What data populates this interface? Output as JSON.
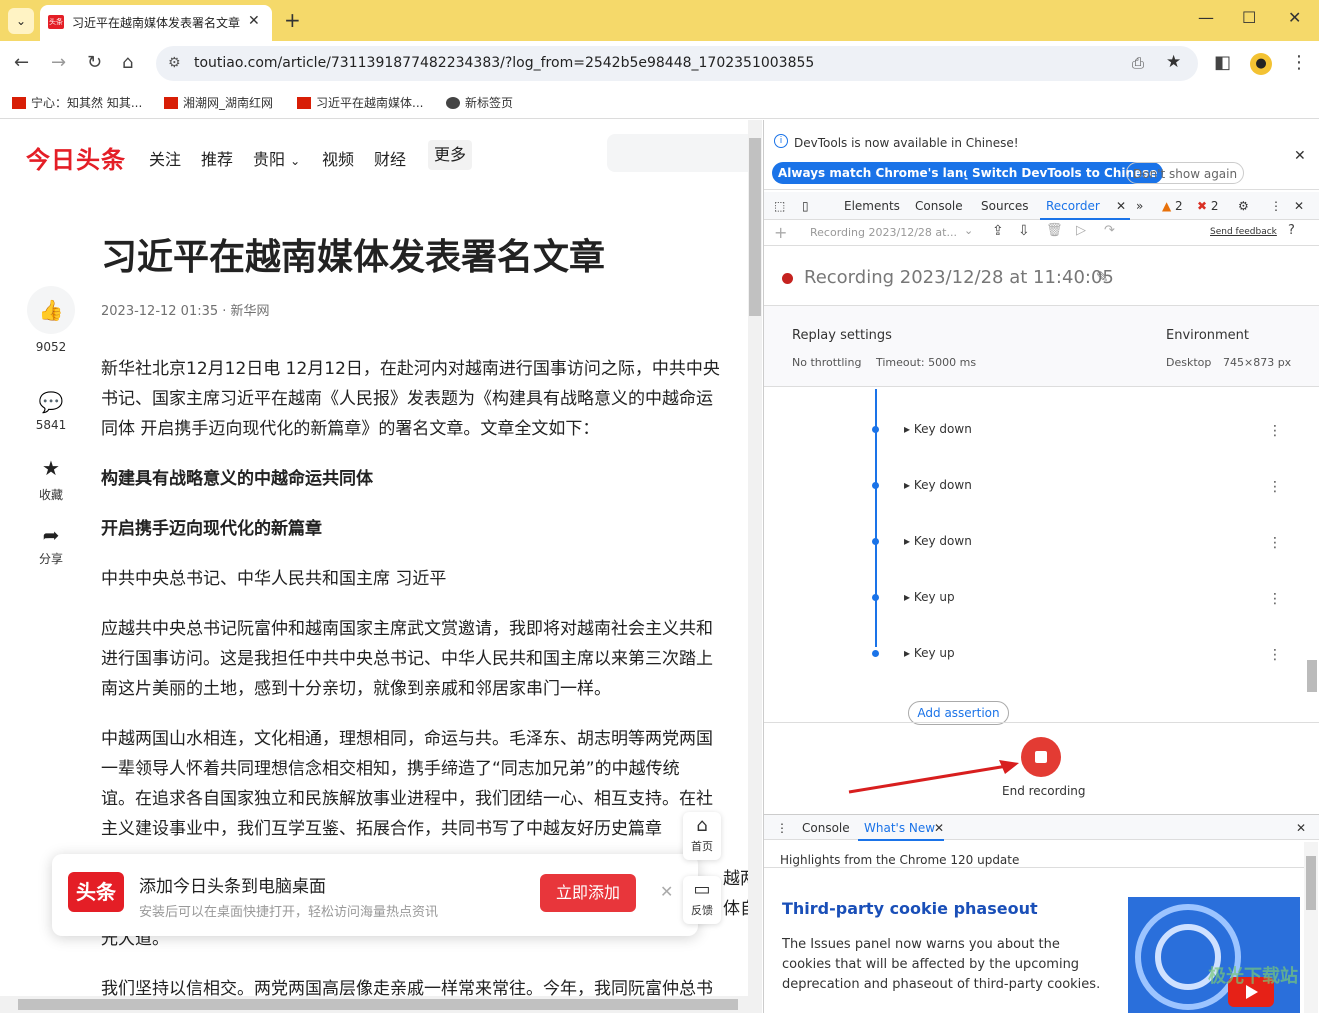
{
  "browser": {
    "tab_title": "习近平在越南媒体发表署名文章",
    "tab_favicon": "头条",
    "url": "toutiao.com/article/7311391877482234383/?log_from=2542b5e98448_1702351003855",
    "bookmarks": [
      "宁心：知其然 知其...",
      "湘潮网_湖南红网",
      "习近平在越南媒体...",
      "新标签页"
    ]
  },
  "site": {
    "logo": "今日头条",
    "nav": [
      "关注",
      "推荐",
      "贵阳",
      "视频",
      "财经"
    ],
    "more": "更多"
  },
  "article": {
    "title": "习近平在越南媒体发表署名文章",
    "meta": "2023-12-12 01:35 · 新华网",
    "likes": "9052",
    "comments": "5841",
    "collect": "收藏",
    "share": "分享",
    "paragraphs": [
      "新华社北京12月12日电 12月12日，在赴河内对越南进行国事访问之际，中共中央",
      "书记、国家主席习近平在越南《人民报》发表题为《构建具有战略意义的中越命运",
      "同体 开启携手迈向现代化的新篇章》的署名文章。文章全文如下：",
      "构建具有战略意义的中越命运共同体",
      "开启携手迈向现代化的新篇章",
      "中共中央总书记、中华人民共和国主席 习近平",
      "应越共中央总书记阮富仲和越南国家主席武文赏邀请，我即将对越南社会主义共和",
      "进行国事访问。这是我担任中共中央总书记、中华人民共和国主席以来第三次踏上",
      "南这片美丽的土地，感到十分亲切，就像到亲戚和邻居家串门一样。",
      "中越两国山水相连，文化相通，理想相同，命运与共。毛泽东、胡志明等两党两国",
      "一辈领导人怀着共同理想信念相交相知，携手缔造了“同志加兄弟”的中越传统",
      "谊。在追求各自国家独立和民族解放事业进程中，我们团结一心、相互支持。在社",
      "主义建设事业中，我们互学互鉴、拓展合作，共同书写了中越友好历史篇章",
      "光大道。",
      "我们坚持以信相交。两党两国高层像走亲戚一样常来常往。今年，我同阮富仲总书"
    ],
    "partial_right": [
      "越两党",
      "体自"
    ]
  },
  "promo": {
    "logo": "头条",
    "title": "添加今日头条到电脑桌面",
    "subtitle": "安装后可以在桌面快捷打开，轻松访问海量热点资讯",
    "button": "立即添加",
    "home": "首页",
    "feedback": "反馈"
  },
  "devtools": {
    "info": "DevTools is now available in Chinese!",
    "btn_match": "Always match Chrome's language",
    "btn_switch": "Switch DevTools to Chinese",
    "btn_dont": "Don't show again",
    "tabs": [
      "Elements",
      "Console",
      "Sources",
      "Recorder"
    ],
    "warn_count": "2",
    "err_count": "2",
    "recording_select": "Recording 2023/12/28 at...",
    "send_feedback": "Send feedback",
    "recording_title": "Recording 2023/12/28 at 11:40:05",
    "replay_settings": "Replay settings",
    "throttling": "No throttling",
    "timeout": "Timeout: 5000 ms",
    "environment": "Environment",
    "device": "Desktop",
    "viewport": "745×873 px",
    "steps": [
      "Key down",
      "Key down",
      "Key down",
      "Key up",
      "Key up"
    ],
    "add_assertion": "Add assertion",
    "end_recording": "End recording",
    "drawer_tabs": [
      "Console",
      "What's New"
    ],
    "highlights": "Highlights from the Chrome 120 update",
    "whatsnew_title": "Third-party cookie phaseout",
    "whatsnew_body": "The Issues panel now warns you about the cookies that will be affected by the upcoming deprecation and phaseout of third-party cookies."
  },
  "watermark": "极光下载站",
  "colors": {
    "brand_red": "#e41e26",
    "accent_blue": "#1a73e8",
    "tabstrip": "#f5d96a"
  }
}
